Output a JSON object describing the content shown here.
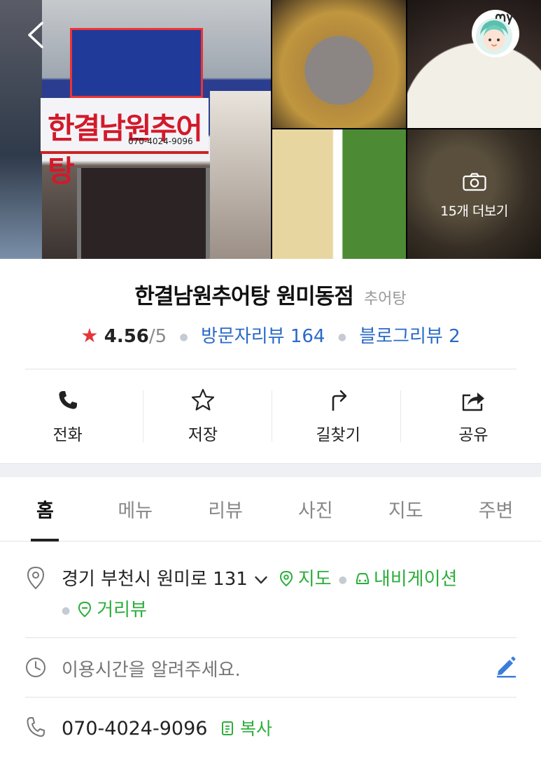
{
  "photos": {
    "more_label": "15개 더보기",
    "main_sign_text": "한결남원추어탕",
    "main_sign_phone": "070-4024-9096"
  },
  "place": {
    "name": "한결남원추어탕 원미동점",
    "category": "추어탕",
    "rating_star": "★",
    "rating": "4.56",
    "rating_max": "/5",
    "visitor_reviews": "방문자리뷰 164",
    "blog_reviews": "블로그리뷰 2"
  },
  "actions": {
    "call": "전화",
    "save": "저장",
    "directions": "길찾기",
    "share": "공유"
  },
  "tabs": [
    {
      "label": "홈",
      "active": true
    },
    {
      "label": "메뉴",
      "active": false
    },
    {
      "label": "리뷰",
      "active": false
    },
    {
      "label": "사진",
      "active": false
    },
    {
      "label": "지도",
      "active": false
    },
    {
      "label": "주변",
      "active": false
    }
  ],
  "info": {
    "address": "경기 부천시 원미로 131",
    "map_link": "지도",
    "navigation_link": "내비게이션",
    "streetview_link": "거리뷰",
    "hours_prompt": "이용시간을 알려주세요.",
    "phone": "070-4024-9096",
    "copy_link": "복사"
  },
  "colors": {
    "star": "#e5363a",
    "link_blue": "#2a6ac7",
    "link_green": "#2bae3b",
    "edit_blue": "#3b7ddd"
  },
  "icons": {
    "back": "chevron-left-icon",
    "profile": "my-avatar-icon",
    "camera": "camera-icon",
    "call": "phone-icon",
    "save": "star-outline-icon",
    "directions": "turn-arrow-icon",
    "share": "share-icon",
    "location": "location-pin-icon",
    "clock": "clock-icon",
    "edit": "pencil-icon",
    "phone_row": "phone-outline-icon",
    "copy": "copy-icon"
  }
}
